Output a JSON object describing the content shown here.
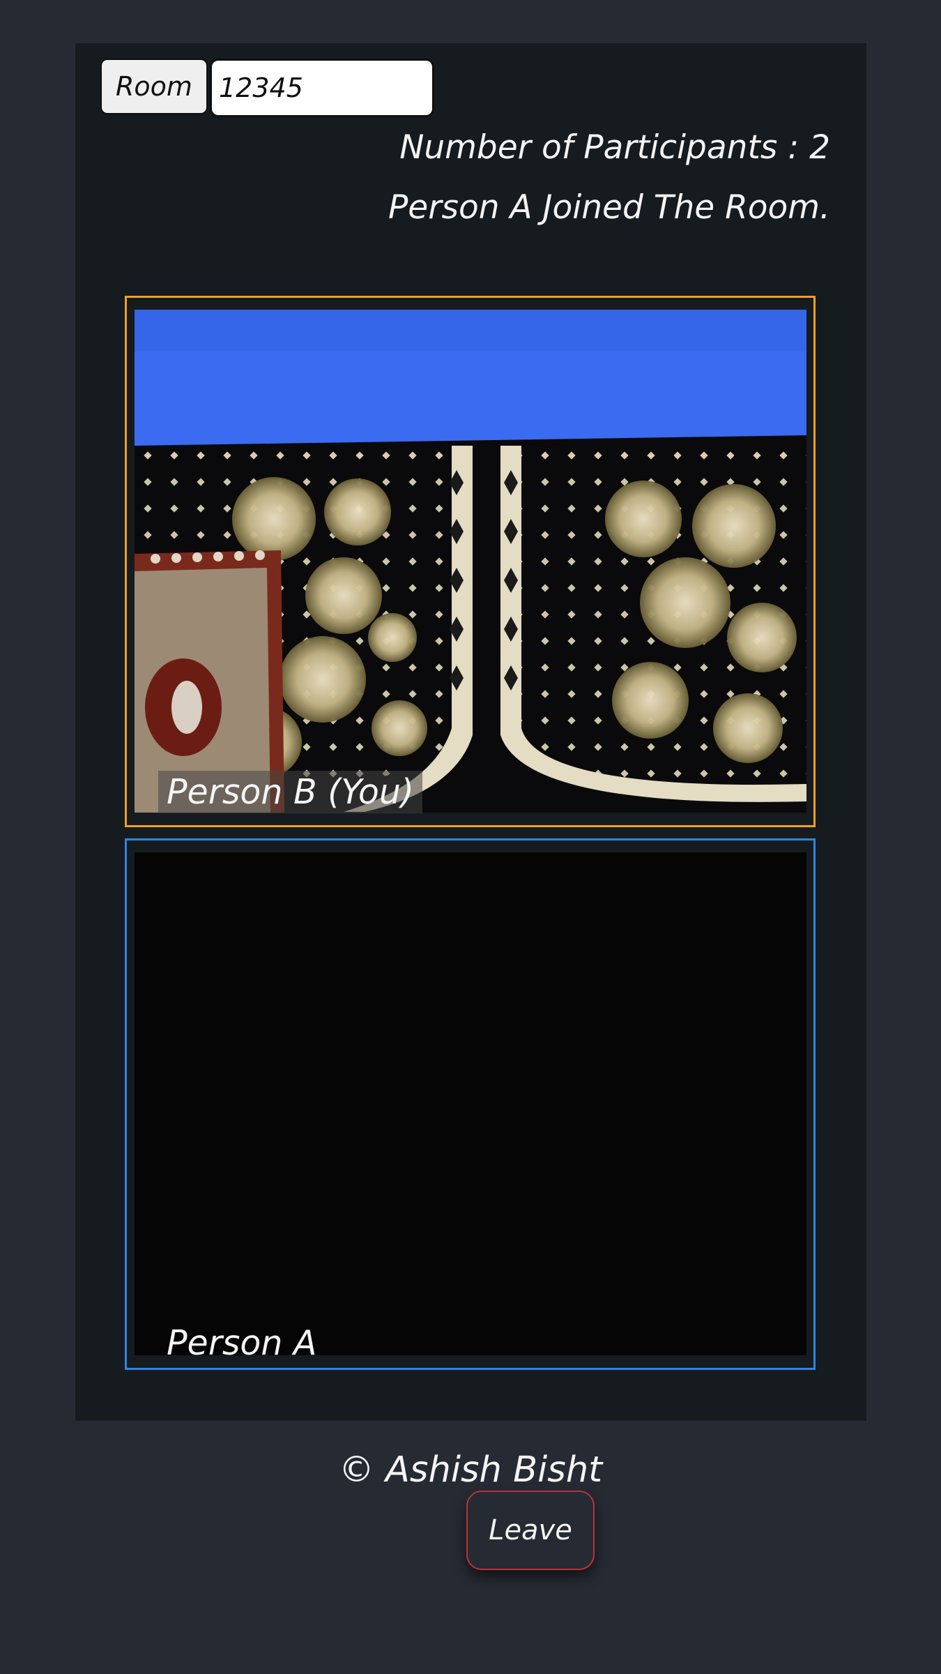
{
  "room": {
    "button_label": "Room",
    "id_value": "12345"
  },
  "status": {
    "participants": "Number of Participants : 2",
    "event": "Person A Joined The Room."
  },
  "tiles": [
    {
      "label": "Person B (You)",
      "border_color": "#f0a024",
      "video": "local-camera-feed"
    },
    {
      "label": "Person A",
      "border_color": "#2f86dd",
      "video": "remote-dark-feed"
    }
  ],
  "footer": {
    "copyright": "© Ashish Bisht"
  },
  "actions": {
    "leave_label": "Leave",
    "leave_border_color": "#c0303a"
  },
  "colors": {
    "page_bg": "#262a33",
    "panel_bg": "#161b20",
    "camera_wall": "#3a6bf0"
  }
}
